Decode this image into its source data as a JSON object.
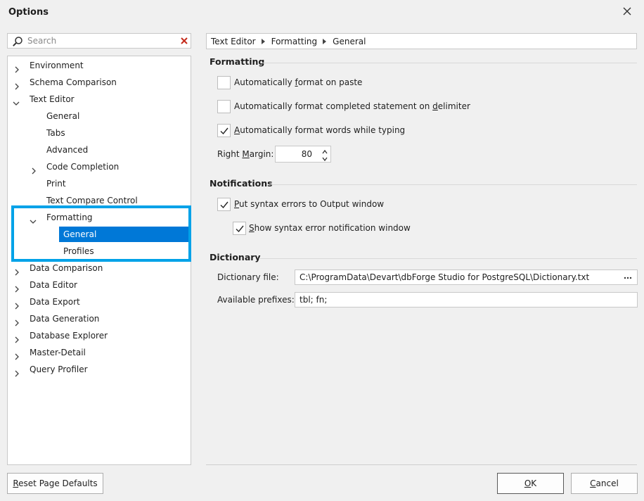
{
  "window": {
    "title": "Options"
  },
  "search": {
    "placeholder": "Search"
  },
  "tree": {
    "environment": "Environment",
    "schema_comparison": "Schema Comparison",
    "text_editor": "Text Editor",
    "general": "General",
    "tabs": "Tabs",
    "advanced": "Advanced",
    "code_completion": "Code Completion",
    "print": "Print",
    "text_compare_control": "Text Compare Control",
    "formatting": "Formatting",
    "formatting_general": "General",
    "profiles": "Profiles",
    "data_comparison": "Data Comparison",
    "data_editor": "Data Editor",
    "data_export": "Data Export",
    "data_generation": "Data Generation",
    "database_explorer": "Database Explorer",
    "master_detail": "Master-Detail",
    "query_profiler": "Query Profiler"
  },
  "breadcrumb": [
    "Text Editor",
    "Formatting",
    "General"
  ],
  "formatting": {
    "header": "Formatting",
    "options": [
      {
        "label": "Automatically format on paste",
        "checked": false
      },
      {
        "label": "Automatically format completed statement on delimiter",
        "checked": false
      },
      {
        "label": "Automatically format words while typing",
        "checked": true
      }
    ],
    "right_margin_label": "Right Margin:",
    "right_margin_value": "80"
  },
  "notifications": {
    "header": "Notifications",
    "options": [
      {
        "label": "Put syntax errors to Output window",
        "checked": true
      },
      {
        "label": "Show syntax error notification window",
        "checked": true
      }
    ]
  },
  "dictionary": {
    "header": "Dictionary",
    "file_label": "Dictionary file:",
    "file_value": "C:\\ProgramData\\Devart\\dbForge Studio for PostgreSQL\\Dictionary.txt",
    "prefixes_label": "Available prefixes:",
    "prefixes_value": "tbl; fn;"
  },
  "buttons": {
    "reset": "Reset Page Defaults",
    "ok": "OK",
    "cancel": "Cancel"
  },
  "colors": {
    "selection": "#0078d7",
    "highlight_box": "#00a2e8",
    "clear_icon": "#c42b1c"
  }
}
